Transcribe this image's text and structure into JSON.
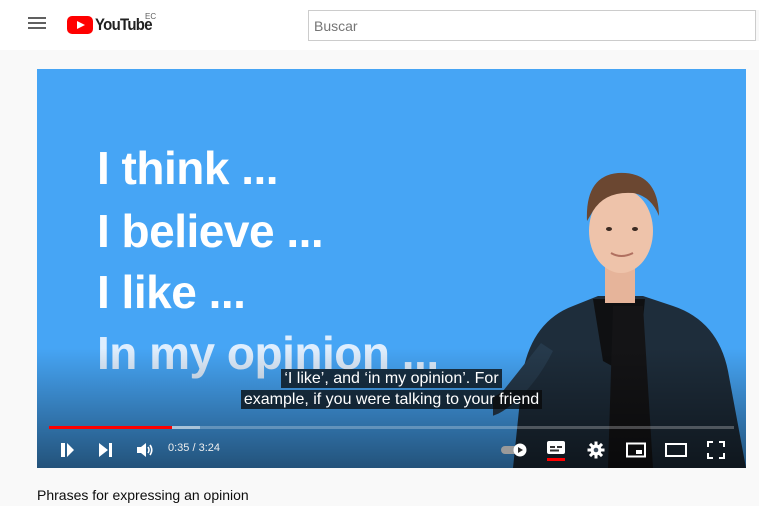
{
  "masthead": {
    "logo_text": "YouTube",
    "country_code": "EC",
    "search_placeholder": "Buscar"
  },
  "video": {
    "slide_lines": [
      "I think ...",
      "I believe ...",
      "I like ...",
      "In my opinion ..."
    ],
    "captions": [
      "‘I like’, and ‘in my opinion’. For",
      "example, if you were talking to your friend"
    ],
    "current_time": "0:35",
    "duration": "3:24",
    "time_display": "0:35 / 3:24",
    "progress_played_fraction": 0.18,
    "progress_loaded_fraction": 0.22,
    "autoplay_on": true,
    "captions_on": true
  },
  "controls": {
    "icons": [
      "pause-icon",
      "next-icon",
      "volume-icon",
      "autoplay-toggle-icon",
      "subtitles-icon",
      "settings-gear-icon",
      "miniplayer-icon",
      "theater-mode-icon",
      "fullscreen-icon"
    ]
  },
  "colors": {
    "brand_red": "#ff0000",
    "slide_blue": "#46a5f5"
  },
  "title": "Phrases for expressing an opinion"
}
